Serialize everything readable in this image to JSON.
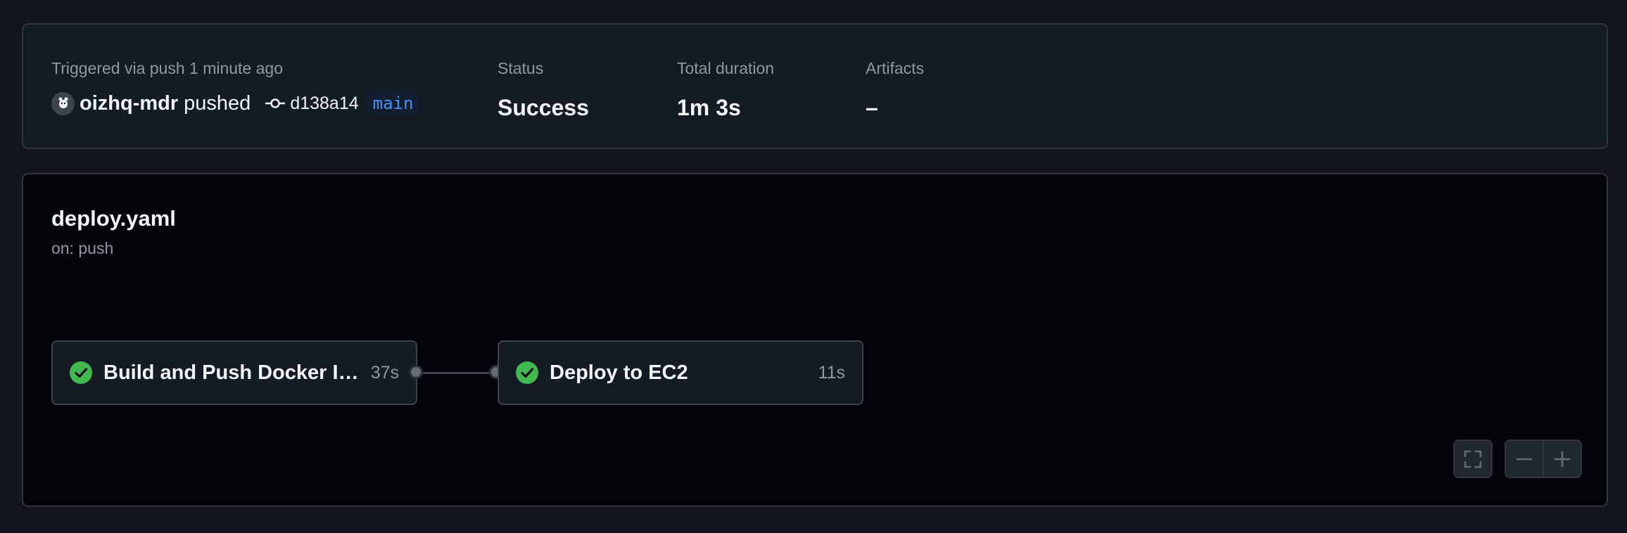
{
  "summary": {
    "trigger_label": "Triggered via push 1 minute ago",
    "actor": "oizhq-mdr",
    "action": "pushed",
    "commit_sha": "d138a14",
    "branch": "main",
    "status_label": "Status",
    "status_value": "Success",
    "duration_label": "Total duration",
    "duration_value": "1m 3s",
    "artifacts_label": "Artifacts",
    "artifacts_value": "–"
  },
  "workflow": {
    "file": "deploy.yaml",
    "trigger": "on: push",
    "jobs": [
      {
        "name": "Build and Push Docker Image",
        "duration": "37s",
        "status": "success"
      },
      {
        "name": "Deploy to EC2",
        "duration": "11s",
        "status": "success"
      }
    ]
  },
  "controls": {
    "fullscreen_icon": "fullscreen-icon",
    "zoom_out_icon": "minus-icon",
    "zoom_in_icon": "plus-icon"
  },
  "colors": {
    "success": "#3fb950",
    "branch": "#4493f8",
    "background": "#12161c",
    "graph_background": "#02040a"
  }
}
